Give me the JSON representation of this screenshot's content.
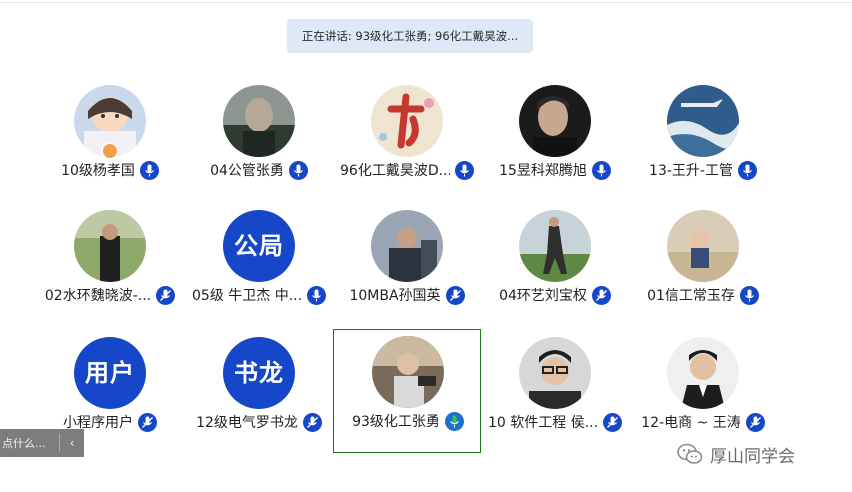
{
  "speaking_banner": "正在讲话: 93级化工张勇; 96化工戴昊波...",
  "participants": [
    {
      "name": "10级杨孝国",
      "avatar_type": "photo"
    },
    {
      "name": "04公管张勇",
      "avatar_type": "photo"
    },
    {
      "name": "96化工戴昊波D...",
      "avatar_type": "photo"
    },
    {
      "name": "15昱科郑腾旭",
      "avatar_type": "photo"
    },
    {
      "name": "13-王升-工管",
      "avatar_type": "photo"
    },
    {
      "name": "02水环魏晓波-...",
      "avatar_type": "photo"
    },
    {
      "name": "05级 牛卫杰 中...",
      "avatar_type": "text",
      "avatar_text": "公局"
    },
    {
      "name": "10MBA孙国英",
      "avatar_type": "photo"
    },
    {
      "name": "04环艺刘宝权",
      "avatar_type": "photo"
    },
    {
      "name": "01信工常玉存",
      "avatar_type": "photo"
    },
    {
      "name": "小程序用户",
      "avatar_type": "text",
      "avatar_text": "用户"
    },
    {
      "name": "12级电气罗书龙",
      "avatar_type": "text",
      "avatar_text": "书龙"
    },
    {
      "name": "93级化工张勇",
      "avatar_type": "photo",
      "active": true
    },
    {
      "name": "10 软件工程 侯...",
      "avatar_type": "photo"
    },
    {
      "name": "12-电商 ~ 王涛",
      "avatar_type": "photo"
    }
  ],
  "side_tab": {
    "label": "点什么...",
    "chevron": "‹"
  },
  "watermark": "厚山同学会",
  "colors": {
    "accent": "#1647c8",
    "active_border": "#1f7a1f",
    "banner_bg": "#dfe8f7"
  }
}
